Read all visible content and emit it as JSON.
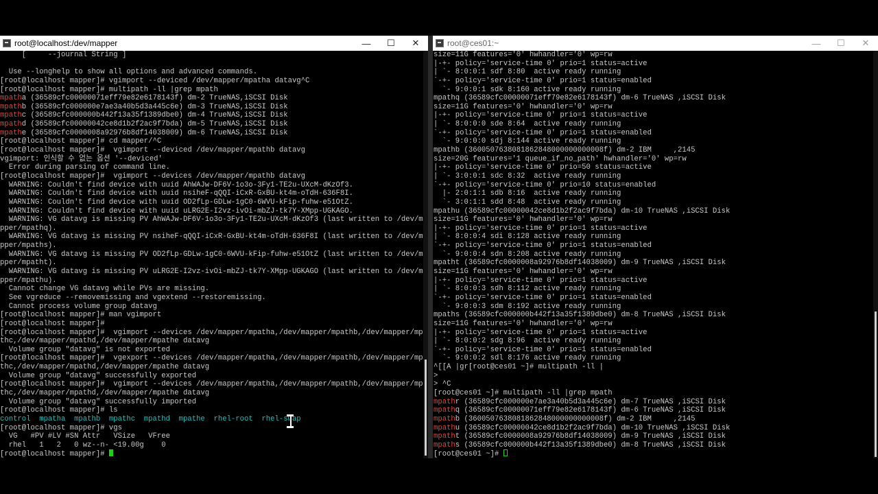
{
  "left_window": {
    "title": "root@localhost:/dev/mapper",
    "buttons": {
      "minimize": "—",
      "maximize": "☐",
      "close": "✕"
    },
    "lines": [
      [
        {
          "t": "     [     --journal String ]"
        }
      ],
      [
        {
          "t": ""
        }
      ],
      [
        {
          "t": "  Use --longhelp to show all options and advanced commands."
        }
      ],
      [
        {
          "t": "[root@localhost mapper]# vgimport --deviced /dev/mapper/mpatha datavg^C"
        }
      ],
      [
        {
          "t": "[root@localhost mapper]# multipath -ll |grep mpath"
        }
      ],
      [
        {
          "t": "mpath",
          "c": "red"
        },
        {
          "t": "a (36589cfc00000071eff79e82e6178143f) dm-2 TrueNAS,iSCSI Disk"
        }
      ],
      [
        {
          "t": "mpath",
          "c": "red"
        },
        {
          "t": "b (36589cfc000000e7ae3a40b5d3a445c6e) dm-3 TrueNAS,iSCSI Disk"
        }
      ],
      [
        {
          "t": "mpath",
          "c": "red"
        },
        {
          "t": "c (36589cfc000000b442f13a35f1389dbe0) dm-4 TrueNAS,iSCSI Disk"
        }
      ],
      [
        {
          "t": "mpath",
          "c": "red"
        },
        {
          "t": "d (36589cfc00000042ce8d1b2f2ac9f7bda) dm-5 TrueNAS,iSCSI Disk"
        }
      ],
      [
        {
          "t": "mpath",
          "c": "red"
        },
        {
          "t": "e (36589cfc0000008a92976b8df14038009) dm-6 TrueNAS,iSCSI Disk"
        }
      ],
      [
        {
          "t": "[root@localhost mapper]# cd mapper/^C"
        }
      ],
      [
        {
          "t": "[root@localhost mapper]#  vgimport --deviced /dev/mapper/mpathb datavg"
        }
      ],
      [
        {
          "t": "vgimport: 인식할 수 없는 옵션 '--deviced'"
        }
      ],
      [
        {
          "t": "  Error during parsing of command line."
        }
      ],
      [
        {
          "t": "[root@localhost mapper]#  vgimport --devices /dev/mapper/mpathb datavg"
        }
      ],
      [
        {
          "t": "  WARNING: Couldn't find device with uuid AhWAJw-DF6V-1o3o-3Fy1-TE2u-UXcM-dKzOf3."
        }
      ],
      [
        {
          "t": "  WARNING: Couldn't find device with uuid nsiheF-qQQI-iCxR-GxBU-kt4m-oTdH-636F8I."
        }
      ],
      [
        {
          "t": "  WARNING: Couldn't find device with uuid OD2fLp-GDLw-1gC0-6WVU-kFip-fuhw-e51OtZ."
        }
      ],
      [
        {
          "t": "  WARNING: Couldn't find device with uuid uLRG2E-I2vz-ivOi-mbZJ-tk7Y-XMpp-UGKAGO."
        }
      ],
      [
        {
          "t": "  WARNING: VG datavg is missing PV AhWAJw-DF6V-1o3o-3Fy1-TE2u-UXcM-dKzOf3 (last written to /dev/ma"
        }
      ],
      [
        {
          "t": "pper/mpathq)."
        }
      ],
      [
        {
          "t": "  WARNING: VG datavg is missing PV nsiheF-qQQI-iCxR-GxBU-kt4m-oTdH-636F8I (last written to /dev/ma"
        }
      ],
      [
        {
          "t": "pper/mpaths)."
        }
      ],
      [
        {
          "t": "  WARNING: VG datavg is missing PV OD2fLp-GDLw-1gC0-6WVU-kFip-fuhw-e51OtZ (last written to /dev/ma"
        }
      ],
      [
        {
          "t": "pper/mpatht)."
        }
      ],
      [
        {
          "t": "  WARNING: VG datavg is missing PV uLRG2E-I2vz-ivOi-mbZJ-tk7Y-XMpp-UGKAGO (last written to /dev/ma"
        }
      ],
      [
        {
          "t": "pper/mpathu)."
        }
      ],
      [
        {
          "t": "  Cannot change VG datavg while PVs are missing."
        }
      ],
      [
        {
          "t": "  See vgreduce --removemissing and vgextend --restoremissing."
        }
      ],
      [
        {
          "t": "  Cannot process volume group datavg"
        }
      ],
      [
        {
          "t": "[root@localhost mapper]# man vgimport"
        }
      ],
      [
        {
          "t": "[root@localhost mapper]#"
        }
      ],
      [
        {
          "t": "[root@localhost mapper]#  vgimport --devices /dev/mapper/mpatha,/dev/mapper/mpathb,/dev/mapper/mpa"
        }
      ],
      [
        {
          "t": "thc,/dev/mapper/mpathd,/dev/mapper/mpathe datavg"
        }
      ],
      [
        {
          "t": "  Volume group \"datavg\" is not exported"
        }
      ],
      [
        {
          "t": "[root@localhost mapper]#  vgexport --devices /dev/mapper/mpatha,/dev/mapper/mpathb,/dev/mapper/mpa"
        }
      ],
      [
        {
          "t": "thc,/dev/mapper/mpathd,/dev/mapper/mpathe datavg"
        }
      ],
      [
        {
          "t": "  Volume group \"datavg\" successfully exported"
        }
      ],
      [
        {
          "t": "[root@localhost mapper]#  vgimport --devices /dev/mapper/mpatha,/dev/mapper/mpathb,/dev/mapper/mpa"
        }
      ],
      [
        {
          "t": "thc,/dev/mapper/mpathd,/dev/mapper/mpathe datavg"
        }
      ],
      [
        {
          "t": "  Volume group \"datavg\" successfully imported"
        }
      ],
      [
        {
          "t": "[root@localhost mapper]# ls"
        }
      ],
      [
        {
          "t": "control  mpatha  mpathb  mpathc  mpathd  mpathe  rhel-root  rhel-swap",
          "c": "teal"
        }
      ],
      [
        {
          "t": "[root@localhost mapper]# vgs"
        }
      ],
      [
        {
          "t": "  VG   #PV #LV #SN Attr   VSize   VFree"
        }
      ],
      [
        {
          "t": "  rhel   1   2   0 wz--n- <19.00g    0"
        }
      ],
      [
        {
          "t": "[root@localhost mapper]# "
        }
      ]
    ]
  },
  "right_window": {
    "title": "root@ces01:~",
    "buttons": {
      "minimize": "—",
      "maximize": "☐",
      "close": "✕"
    },
    "lines": [
      [
        {
          "t": "size=11G features='0' hwhandler='0' wp=rw"
        }
      ],
      [
        {
          "t": "|-+- policy='service-time 0' prio=1 status=active"
        }
      ],
      [
        {
          "t": "| `- 8:0:0:1 sdf 8:80  active ready running"
        }
      ],
      [
        {
          "t": "`-+- policy='service-time 0' prio=1 status=enabled"
        }
      ],
      [
        {
          "t": "  `- 9:0:0:1 sdk 8:160 active ready running"
        }
      ],
      [
        {
          "t": "mpathq (36589cfc00000071eff79e82e6178143f) dm-6 TrueNAS ,iSCSI Disk"
        }
      ],
      [
        {
          "t": "size=11G features='0' hwhandler='0' wp=rw"
        }
      ],
      [
        {
          "t": "|-+- policy='service-time 0' prio=1 status=active"
        }
      ],
      [
        {
          "t": "| `- 8:0:0:0 sde 8:64  active ready running"
        }
      ],
      [
        {
          "t": "`-+- policy='service-time 0' prio=1 status=enabled"
        }
      ],
      [
        {
          "t": "  `- 9:0:0:0 sdj 8:144 active ready running"
        }
      ],
      [
        {
          "t": "mpathb (3600507638081862848000000000008f) dm-2 IBM     ,2145"
        }
      ],
      [
        {
          "t": "size=20G features='1 queue_if_no_path' hwhandler='0' wp=rw"
        }
      ],
      [
        {
          "t": "|-+- policy='service-time 0' prio=50 status=active"
        }
      ],
      [
        {
          "t": "| `- 3:0:0:1 sdc 8:32  active ready running"
        }
      ],
      [
        {
          "t": "`-+- policy='service-time 0' prio=10 status=enabled"
        }
      ],
      [
        {
          "t": "  |- 2:0:1:1 sdb 8:16  active ready running"
        }
      ],
      [
        {
          "t": "  `- 3:0:1:1 sdd 8:48  active ready running"
        }
      ],
      [
        {
          "t": "mpathu (36589cfc00000042ce8d1b2f2ac9f7bda) dm-10 TrueNAS ,iSCSI Disk"
        }
      ],
      [
        {
          "t": "size=11G features='0' hwhandler='0' wp=rw"
        }
      ],
      [
        {
          "t": "|-+- policy='service-time 0' prio=1 status=active"
        }
      ],
      [
        {
          "t": "| `- 8:0:0:4 sdi 8:128 active ready running"
        }
      ],
      [
        {
          "t": "`-+- policy='service-time 0' prio=1 status=enabled"
        }
      ],
      [
        {
          "t": "  `- 9:0:0:4 sdn 8:208 active ready running"
        }
      ],
      [
        {
          "t": "mpatht (36589cfc0000008a92976b8df14038009) dm-9 TrueNAS ,iSCSI Disk"
        }
      ],
      [
        {
          "t": "size=11G features='0' hwhandler='0' wp=rw"
        }
      ],
      [
        {
          "t": "|-+- policy='service-time 0' prio=1 status=active"
        }
      ],
      [
        {
          "t": "| `- 8:0:0:3 sdh 8:112 active ready running"
        }
      ],
      [
        {
          "t": "`-+- policy='service-time 0' prio=1 status=enabled"
        }
      ],
      [
        {
          "t": "  `- 9:0:0:3 sdm 8:192 active ready running"
        }
      ],
      [
        {
          "t": "mpaths (36589cfc000000b442f13a35f1389dbe0) dm-8 TrueNAS ,iSCSI Disk"
        }
      ],
      [
        {
          "t": "size=11G features='0' hwhandler='0' wp=rw"
        }
      ],
      [
        {
          "t": "|-+- policy='service-time 0' prio=1 status=active"
        }
      ],
      [
        {
          "t": "| `- 8:0:0:2 sdg 8:96  active ready running"
        }
      ],
      [
        {
          "t": "`-+- policy='service-time 0' prio=1 status=enabled"
        }
      ],
      [
        {
          "t": "  `- 9:0:0:2 sdl 8:176 active ready running"
        }
      ],
      [
        {
          "t": "^[[A |gr[root@ces01 ~]# multipath -ll |"
        }
      ],
      [
        {
          "t": ">"
        }
      ],
      [
        {
          "t": "> ^C"
        }
      ],
      [
        {
          "t": "[root@ces01 ~]# multipath -ll |grep mpath"
        }
      ],
      [
        {
          "t": "mpath",
          "c": "red"
        },
        {
          "t": "r (36589cfc000000e7ae3a40b5d3a445c6e) dm-7 TrueNAS ,iSCSI Disk"
        }
      ],
      [
        {
          "t": "mpath",
          "c": "red"
        },
        {
          "t": "q (36589cfc00000071eff79e82e6178143f) dm-6 TrueNAS ,iSCSI Disk"
        }
      ],
      [
        {
          "t": "mpath",
          "c": "red"
        },
        {
          "t": "b (3600507638081862848000000000008f) dm-2 IBM     ,2145"
        }
      ],
      [
        {
          "t": "mpath",
          "c": "red"
        },
        {
          "t": "u (36589cfc00000042ce8d1b2f2ac9f7bda) dm-10 TrueNAS ,iSCSI Disk"
        }
      ],
      [
        {
          "t": "mpath",
          "c": "red"
        },
        {
          "t": "t (36589cfc0000008a92976b8df14038009) dm-9 TrueNAS ,iSCSI Disk"
        }
      ],
      [
        {
          "t": "mpath",
          "c": "red"
        },
        {
          "t": "s (36589cfc000000b442f13a35f1389dbe0) dm-8 TrueNAS ,iSCSI Disk"
        }
      ],
      [
        {
          "t": "[root@ces01 ~]# "
        }
      ]
    ]
  }
}
